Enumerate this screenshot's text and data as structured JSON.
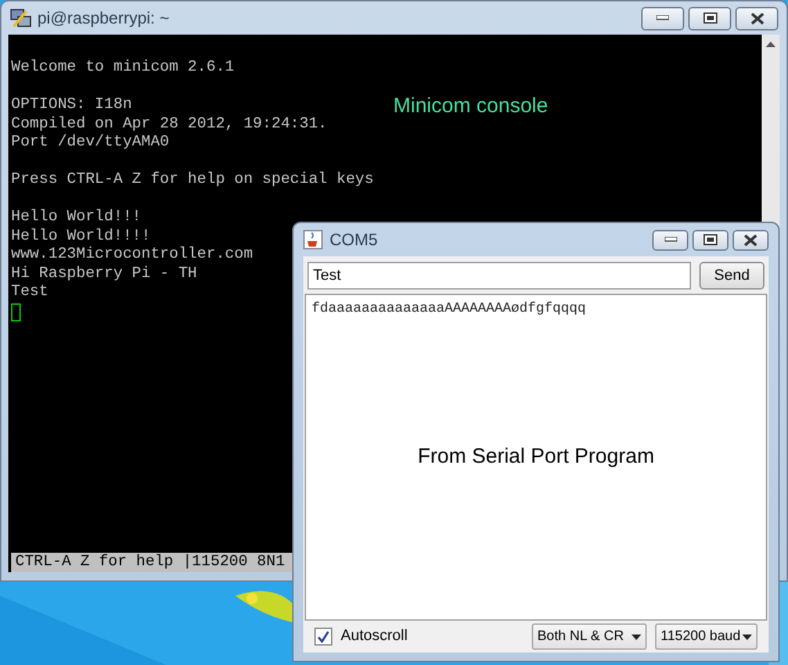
{
  "terminal_window": {
    "title": "pi@raspberrypi: ~",
    "blocks": [
      [
        "Welcome to minicom 2.6.1"
      ],
      [
        "OPTIONS: I18n",
        "Compiled on Apr 28 2012, 19:24:31.",
        "Port /dev/ttyAMA0"
      ],
      [
        "Press CTRL-A Z for help on special keys"
      ],
      [
        "Hello World!!!",
        "Hello World!!!!",
        "www.123Microcontroller.com",
        "Hi Raspberry Pi - TH",
        "Test"
      ]
    ],
    "cursor": true,
    "annotation": "Minicom console",
    "status_bar": "CTRL-A Z for help |115200 8N1"
  },
  "serial_window": {
    "title": "COM5",
    "input": {
      "value": "Test"
    },
    "send_button": "Send",
    "output": "fdaaaaaaaaaaaaaaAAAAAAAAødfgfqqqq",
    "annotation": "From Serial Port Program",
    "autoscroll": {
      "label": "Autoscroll",
      "checked": true
    },
    "line_ending": "Both NL & CR",
    "baud": "115200 baud"
  }
}
